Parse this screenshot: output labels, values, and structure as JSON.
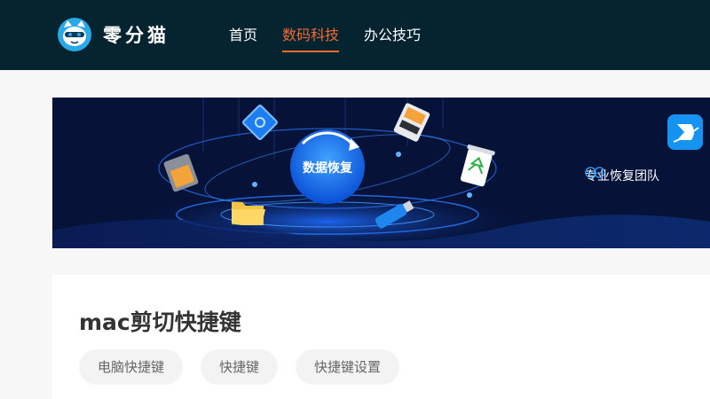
{
  "header": {
    "logo_text": "零分猫",
    "nav": [
      {
        "label": "首页",
        "active": false
      },
      {
        "label": "数码科技",
        "active": true
      },
      {
        "label": "办公技巧",
        "active": false
      }
    ]
  },
  "banner": {
    "circle_text": "数据恢复",
    "badge_text": "专业恢复团队"
  },
  "article": {
    "title": "mac剪切快捷键",
    "tags": [
      "电脑快捷键",
      "快捷键",
      "快捷键设置"
    ]
  },
  "colors": {
    "header_bg": "#052430",
    "accent": "#f16a32",
    "banner_bg": "#061238"
  }
}
